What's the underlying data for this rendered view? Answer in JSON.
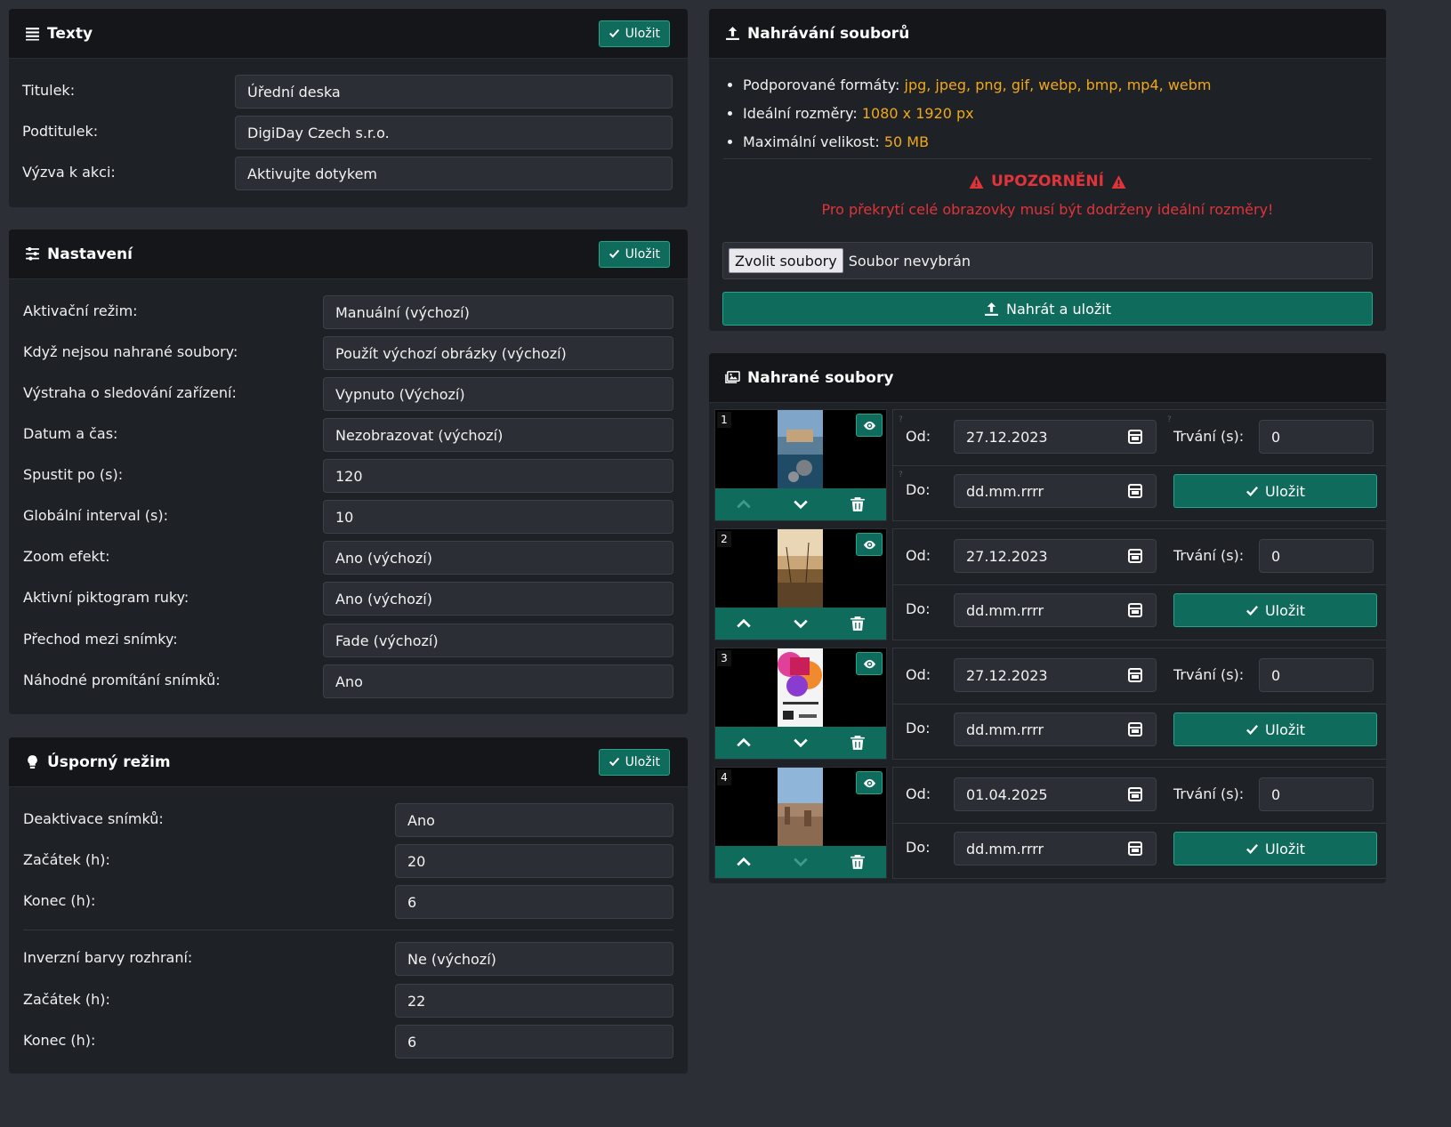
{
  "texty": {
    "title": "Texty",
    "save_label": "Uložit",
    "fields": [
      {
        "label": "Titulek:",
        "value": "Úřední deska"
      },
      {
        "label": "Podtitulek:",
        "value": "DigiDay Czech s.r.o."
      },
      {
        "label": "Výzva k akci:",
        "value": "Aktivujte dotykem"
      }
    ]
  },
  "nastaveni": {
    "title": "Nastavení",
    "save_label": "Uložit",
    "fields": [
      {
        "label": "Aktivační režim:",
        "value": "Manuální (výchozí)"
      },
      {
        "label": "Když nejsou nahrané soubory:",
        "value": "Použít výchozí obrázky (výchozí)"
      },
      {
        "label": "Výstraha o sledování zařízení:",
        "value": "Vypnuto (Výchozí)"
      },
      {
        "label": "Datum a čas:",
        "value": "Nezobrazovat (výchozí)"
      },
      {
        "label": "Spustit po (s):",
        "value": "120"
      },
      {
        "label": "Globální interval (s):",
        "value": "10"
      },
      {
        "label": "Zoom efekt:",
        "value": "Ano (výchozí)"
      },
      {
        "label": "Aktivní piktogram ruky:",
        "value": "Ano (výchozí)"
      },
      {
        "label": "Přechod mezi snímky:",
        "value": "Fade (výchozí)"
      },
      {
        "label": "Náhodné promítání snímků:",
        "value": "Ano"
      }
    ]
  },
  "usporny": {
    "title": "Úsporný režim",
    "save_label": "Uložit",
    "group1": [
      {
        "label": "Deaktivace snímků:",
        "value": "Ano"
      },
      {
        "label": "Začátek (h):",
        "value": "20"
      },
      {
        "label": "Konec (h):",
        "value": "6"
      }
    ],
    "group2": [
      {
        "label": "Inverzní barvy rozhraní:",
        "value": "Ne (výchozí)"
      },
      {
        "label": "Začátek (h):",
        "value": "22"
      },
      {
        "label": "Konec (h):",
        "value": "6"
      }
    ]
  },
  "upload": {
    "title": "Nahrávání souborů",
    "formats_label": "Podporované formáty:",
    "formats_value": "jpg, jpeg, png, gif, webp, bmp, mp4, webm",
    "dims_label": "Ideální rozměry:",
    "dims_value": "1080 x 1920 px",
    "size_label": "Maximální velikost:",
    "size_value": "50 MB",
    "warning_title": "UPOZORNĚNÍ",
    "warning_text": "Pro překrytí celé obrazovky musí být dodrženy ideální rozměry!",
    "choose_label": "Zvolit soubory",
    "no_file": "Soubor nevybrán",
    "upload_label": "Nahrát a uložit"
  },
  "files": {
    "title": "Nahrané soubory",
    "from_label": "Od:",
    "to_label": "Do:",
    "duration_label": "Trvání (s):",
    "save_label": "Uložit",
    "items": [
      {
        "num": "1",
        "from": "27.12.2023",
        "to": "dd.mm.rrrr",
        "duration": "0",
        "up_disabled": true,
        "down_disabled": false
      },
      {
        "num": "2",
        "from": "27.12.2023",
        "to": "dd.mm.rrrr",
        "duration": "0",
        "up_disabled": false,
        "down_disabled": false
      },
      {
        "num": "3",
        "from": "27.12.2023",
        "to": "dd.mm.rrrr",
        "duration": "0",
        "up_disabled": false,
        "down_disabled": false
      },
      {
        "num": "4",
        "from": "01.04.2025",
        "to": "dd.mm.rrrr",
        "duration": "0",
        "up_disabled": false,
        "down_disabled": true
      }
    ]
  },
  "colors": {
    "accent": "#0f6b5c",
    "warning": "#e0343a",
    "highlight": "#f0a81c"
  }
}
